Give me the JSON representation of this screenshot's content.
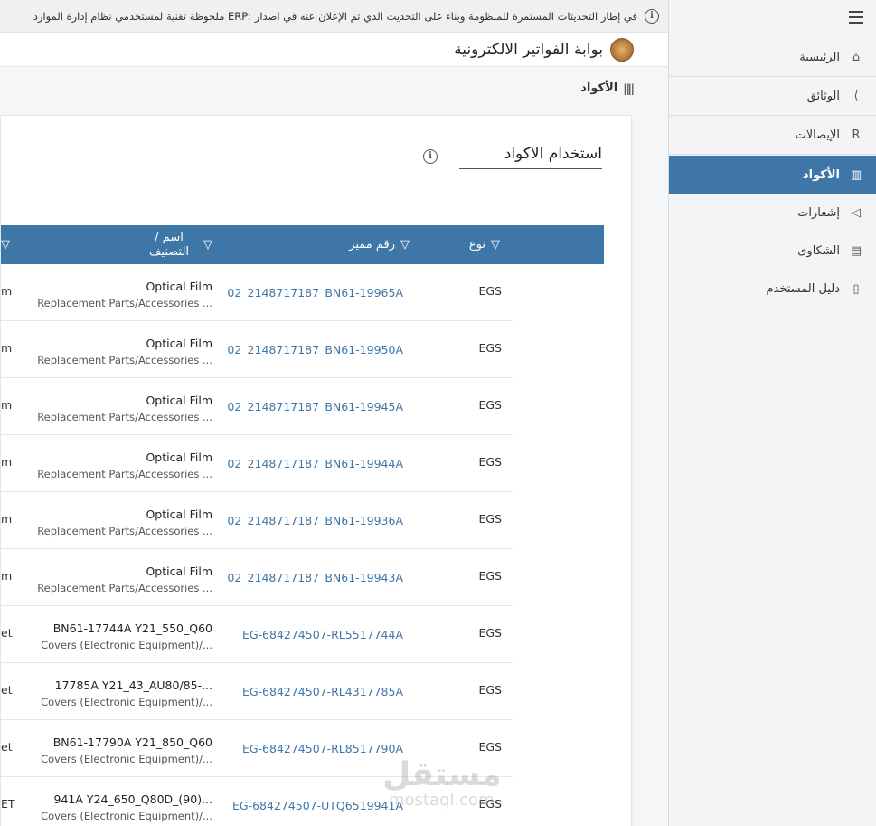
{
  "notice": {
    "text": "ملحوظة تقنية لمستخدمي نظام إدارة الموارد ERP: في إطار التحديثات المستمرة للمنظومة وبناء على التحديث الذي تم الإعلان عنه في اصدار"
  },
  "portal": {
    "title": "بوابة الفواتير الالكترونية"
  },
  "breadcrumb": {
    "label": "الأكواد"
  },
  "sidebar": {
    "items": [
      {
        "label": "الرئيسية",
        "icon": "home-icon",
        "glyph": "⌂"
      },
      {
        "label": "الوثائق",
        "icon": "documents-icon",
        "glyph": "⟨"
      },
      {
        "label": "الإيصالات",
        "icon": "receipts-icon",
        "glyph": "R"
      },
      {
        "label": "الأكواد",
        "icon": "barcode-icon",
        "glyph": "▥"
      },
      {
        "label": "إشعارات",
        "icon": "megaphone-icon",
        "glyph": "◁"
      },
      {
        "label": "الشكاوى",
        "icon": "complaint-icon",
        "glyph": "▤"
      },
      {
        "label": "دليل المستخدم",
        "icon": "book-icon",
        "glyph": "▯"
      }
    ]
  },
  "section": {
    "title": "استخدام الاكواد"
  },
  "table": {
    "headers": {
      "type": "نوع",
      "code": "رقم مميز",
      "name": "اسم / التصنيف"
    },
    "rows": [
      {
        "type": "EGS",
        "code": "02_2148717187_BN61-19965A",
        "name": "Optical Film",
        "category": "Replacement Parts/Accessories ...",
        "edge": "m"
      },
      {
        "type": "EGS",
        "code": "02_2148717187_BN61-19950A",
        "name": "Optical Film",
        "category": "Replacement Parts/Accessories ...",
        "edge": "m"
      },
      {
        "type": "EGS",
        "code": "02_2148717187_BN61-19945A",
        "name": "Optical Film",
        "category": "Replacement Parts/Accessories ...",
        "edge": "m"
      },
      {
        "type": "EGS",
        "code": "02_2148717187_BN61-19944A",
        "name": "Optical Film",
        "category": "Replacement Parts/Accessories ...",
        "edge": "m"
      },
      {
        "type": "EGS",
        "code": "02_2148717187_BN61-19936A",
        "name": "Optical Film",
        "category": "Replacement Parts/Accessories ...",
        "edge": "m"
      },
      {
        "type": "EGS",
        "code": "02_2148717187_BN61-19943A",
        "name": "Optical Film",
        "category": "Replacement Parts/Accessories ...",
        "edge": "m"
      },
      {
        "type": "EGS",
        "code": "EG-684274507-RL5517744A",
        "name": "BN61-17744A Y21_550_Q60",
        "category": "Covers (Electronic Equipment)/...",
        "edge": "et"
      },
      {
        "type": "EGS",
        "code": "EG-684274507-RL4317785A",
        "name": "17785A Y21_43_AU80/85-...",
        "category": "Covers (Electronic Equipment)/...",
        "edge": "et"
      },
      {
        "type": "EGS",
        "code": "EG-684274507-RL8517790A",
        "name": "BN61-17790A Y21_850_Q60",
        "category": "Covers (Electronic Equipment)/...",
        "edge": "et"
      },
      {
        "type": "EGS",
        "code": "EG-684274507-UTQ6519941A",
        "name": "941A Y24_650_Q80D_(90)...",
        "category": "Covers (Electronic Equipment)/...",
        "edge": "ET"
      }
    ]
  },
  "watermark": {
    "brand": "مستقل",
    "domain": "mostaql.com"
  }
}
